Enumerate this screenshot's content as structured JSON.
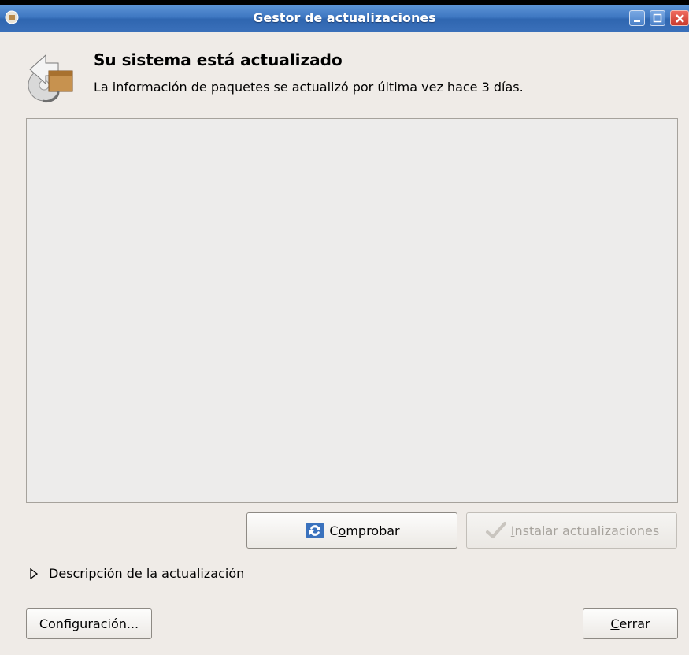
{
  "window": {
    "title": "Gestor de actualizaciones",
    "controls": {
      "minimize": "minimize",
      "maximize": "maximize",
      "close": "close"
    }
  },
  "header": {
    "headline": "Su sistema está actualizado",
    "status": "La información de paquetes se actualizó por última vez hace 3 días.",
    "icon": "update-package-icon"
  },
  "updates_list": {
    "items": []
  },
  "actions": {
    "check": {
      "prefix": "C",
      "mnemonic": "o",
      "rest": "mprobar",
      "icon": "refresh-icon",
      "enabled": true
    },
    "install": {
      "mnemonic": "I",
      "rest": "nstalar actualizaciones",
      "icon": "checkmark-icon",
      "enabled": false
    }
  },
  "details": {
    "label": "Descripción de la actualización",
    "expanded": false
  },
  "footer": {
    "settings_label": "Configuración...",
    "close": {
      "mnemonic": "C",
      "rest": "errar"
    }
  },
  "colors": {
    "titlebar": "#3f78c2",
    "window_bg": "#efebe7",
    "disabled_text": "#a7a39d"
  }
}
